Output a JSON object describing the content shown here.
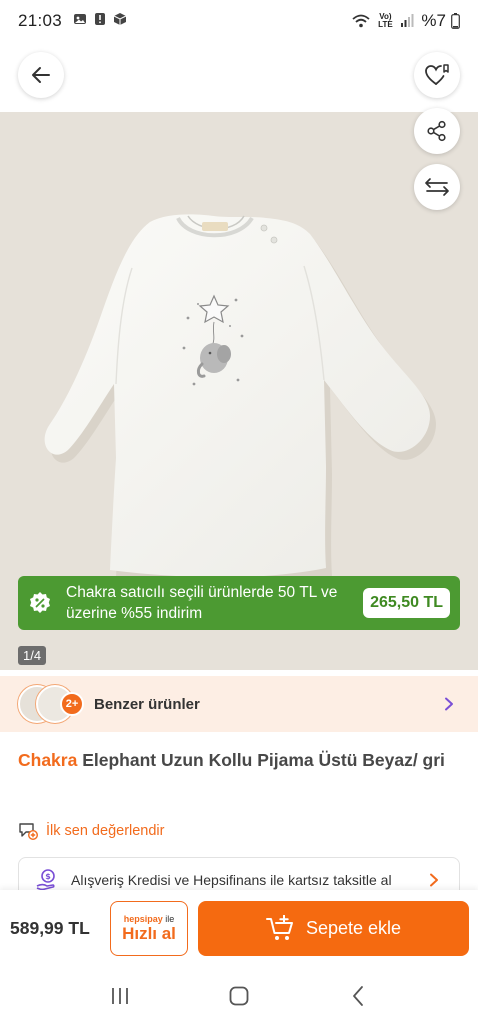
{
  "status_bar": {
    "time": "21:03",
    "lte_label": "Vo) LTE",
    "battery": "%7"
  },
  "header": {
    "back_icon": "arrow-left-icon",
    "favorite_icon": "heart-list-icon",
    "share_icon": "share-icon",
    "compare_icon": "compare-arrows-icon"
  },
  "image": {
    "counter": "1/4"
  },
  "promo": {
    "text": "Chakra satıcılı seçili ürünlerde 50 TL ve üzerine %55 indirim",
    "price": "265,50 TL",
    "color": "#4c9a32"
  },
  "similar": {
    "count": "2+",
    "label": "Benzer ürünler"
  },
  "product": {
    "brand": "Chakra",
    "name": "Elephant Uzun Kollu Pijama Üstü Beyaz/ gri"
  },
  "rating": {
    "label": "İlk sen değerlendir"
  },
  "credit": {
    "text": "Alışveriş Kredisi ve Hepsifinans ile kartsız taksitle al"
  },
  "bottom": {
    "price": "589,99 TL",
    "quick_top_brand": "hepsipay",
    "quick_top_suffix": "ile",
    "quick_label": "Hızlı al",
    "cart_label": "Sepete ekle",
    "accent": "#f26b1d"
  }
}
